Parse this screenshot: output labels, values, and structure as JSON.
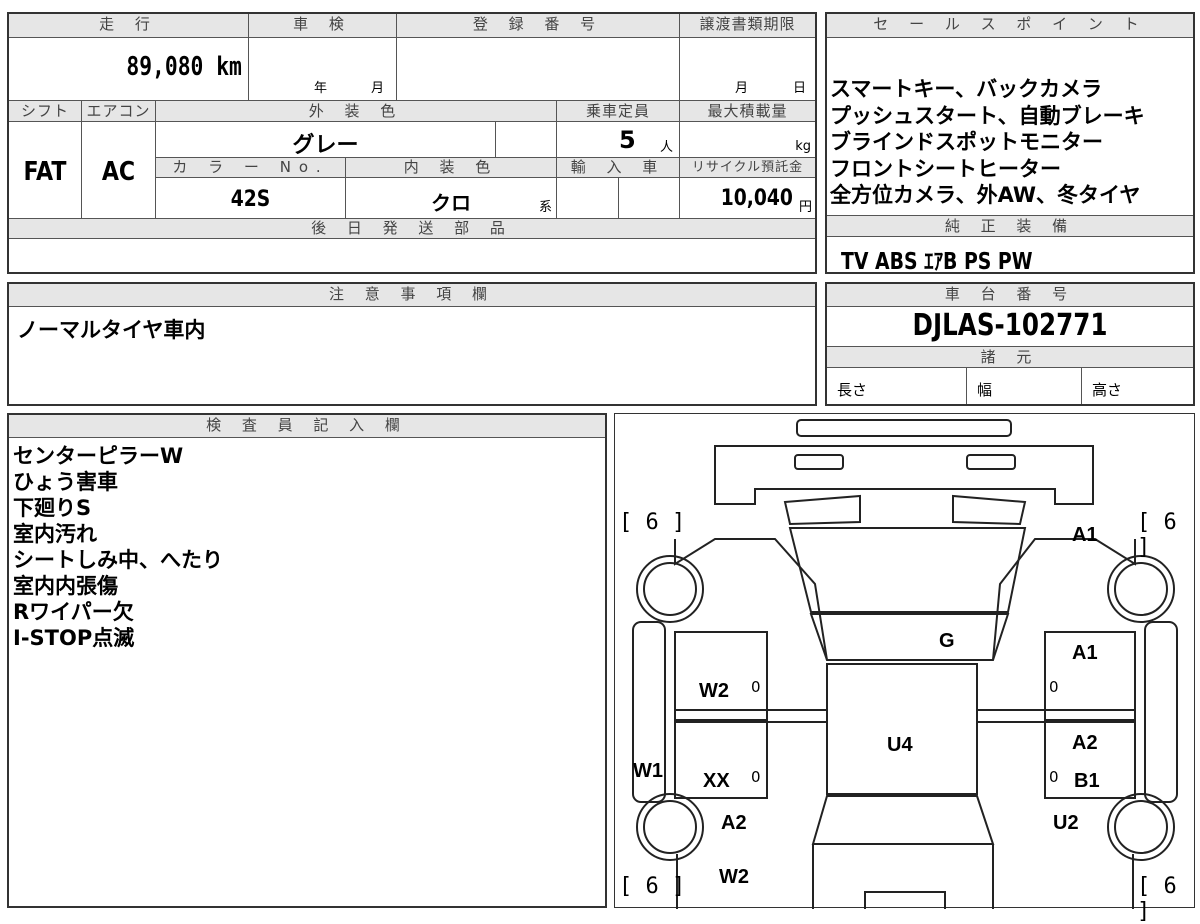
{
  "top_left": {
    "mileage_header": "走 行",
    "mileage_value": "89,080 km",
    "shaken_header": "車 検",
    "shaken_year": "年",
    "shaken_month": "月",
    "reg_header": "登 録 番 号",
    "transfer_header": "譲渡書類期限",
    "transfer_month": "月",
    "transfer_day": "日",
    "shift_header": "シフト",
    "shift_value": "FAT",
    "ac_header": "エアコン",
    "ac_value": "AC",
    "exterior_header": "外 装 色",
    "exterior_value": "グレー",
    "capacity_header": "乗車定員",
    "capacity_value": "5",
    "capacity_unit": "人",
    "maxload_header": "最大積載量",
    "maxload_unit": "kg",
    "color_no_header": "カ ラ ー No.",
    "color_no_value": "42S",
    "interior_header": "内 装 色",
    "interior_value": "クロ",
    "interior_suffix": "系",
    "import_header": "輸 入 車",
    "recycle_header": "リサイクル預託金",
    "recycle_value": "10,040",
    "recycle_unit": "円",
    "later_parts_header": "後 日 発 送 部 品"
  },
  "sales_points": {
    "header": "セ ー ル ス ポ イ ン ト",
    "lines": [
      "スマートキー、バックカメラ",
      "プッシュスタート、自動ブレーキ",
      "ブラインドスポットモニター",
      "フロントシートヒーター",
      "全方位カメラ、外AW、冬タイヤ"
    ]
  },
  "equipment": {
    "header": "純 正 装 備",
    "value": "TV ABS ｴｱB PS PW"
  },
  "notes": {
    "header": "注 意 事 項 欄",
    "value": "ノーマルタイヤ車内"
  },
  "chassis": {
    "header": "車 台 番 号",
    "value": "DJLAS-102771",
    "specs_header": "諸 元",
    "length": "長さ",
    "width": "幅",
    "height": "高さ"
  },
  "inspector": {
    "header": "検 査 員 記 入 欄",
    "lines": [
      "センターピラーW",
      "ひょう害車",
      "下廻りS",
      "室内汚れ",
      "シートしみ中、へたり",
      "室内内張傷",
      "Rワイパー欠",
      "I-STOP点滅"
    ]
  },
  "diagram": {
    "tire_fl": "[ 6 ]",
    "tire_fr": "[ 6 ]",
    "tire_rl": "[ 6 ]",
    "tire_rr": "[ 6 ]",
    "marks": {
      "front_right_fender": "A1",
      "front_right_door": "A1",
      "hood": "G",
      "left_front_door": "W2",
      "roof": "U4",
      "right_rear_door": "A2",
      "right_rear_lower": "B1",
      "left_pillar": "W1",
      "left_rear_door": "XX",
      "left_rear_fender": "A2",
      "left_rear_lower": "W2",
      "right_rear_fender": "U2"
    },
    "zeros": [
      "0",
      "0",
      "0",
      "0"
    ]
  }
}
